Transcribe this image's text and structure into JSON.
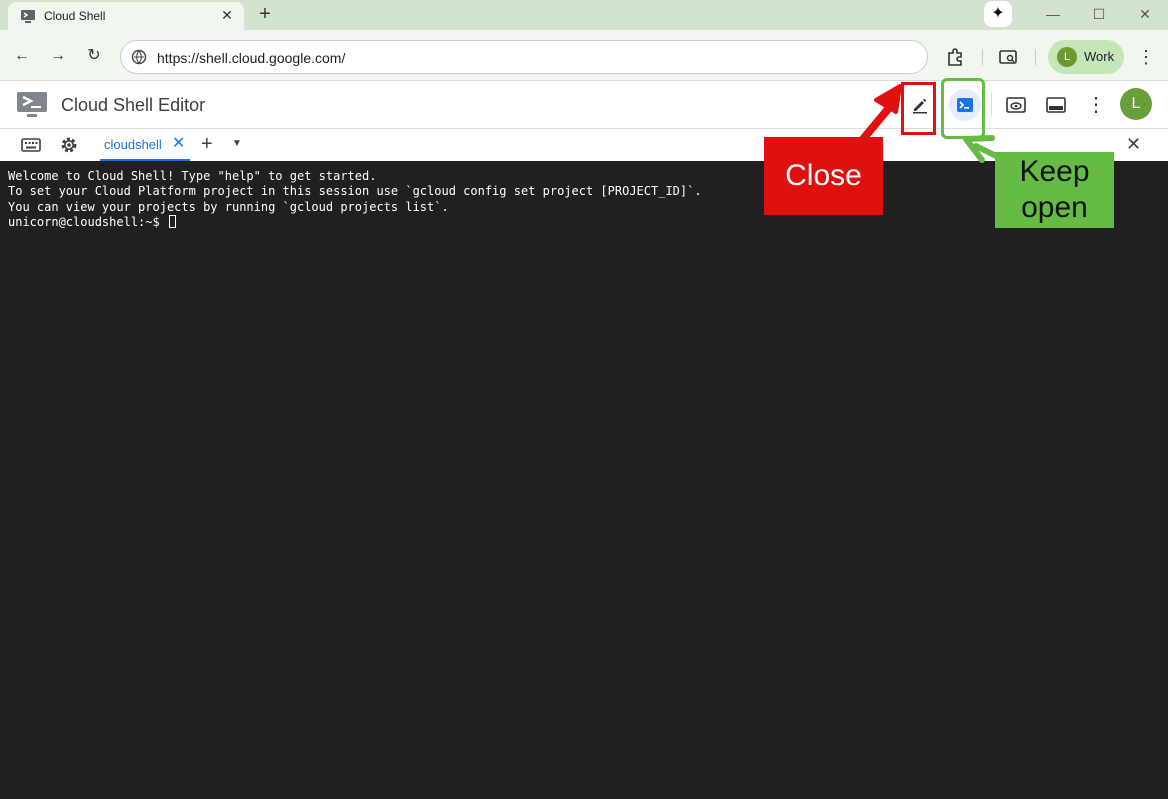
{
  "browser": {
    "tab_title": "Cloud Shell",
    "url": "https://shell.cloud.google.com/",
    "profile_initial": "L",
    "profile_label": "Work"
  },
  "app": {
    "title": "Cloud Shell Editor",
    "avatar_initial": "L"
  },
  "terminal_tabs": [
    {
      "label": "cloudshell"
    }
  ],
  "terminal": {
    "lines": [
      "Welcome to Cloud Shell! Type \"help\" to get started.",
      "To set your Cloud Platform project in this session use `gcloud config set project [PROJECT_ID]`.",
      "You can view your projects by running `gcloud projects list`."
    ],
    "prompt": "unicorn@cloudshell:~$ "
  },
  "annotations": {
    "close_label": "Close",
    "keep_open_line1": "Keep",
    "keep_open_line2": "open",
    "close_color": "#e01010",
    "keep_open_color": "#66bb44"
  },
  "colors": {
    "tabstrip": "#d3e3d0",
    "toolbar": "#f1f6ef",
    "accent": "#1a73e8",
    "terminal_bg": "#202020"
  }
}
